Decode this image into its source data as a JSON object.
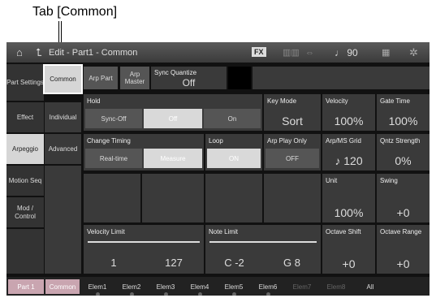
{
  "callout": {
    "label": "Tab [Common]"
  },
  "topbar": {
    "title": "Edit - Part1 - Common",
    "fx": "FX",
    "tempo": "♩ 90"
  },
  "left_tabs": [
    "Part Settings",
    "Effect",
    "Arpeggio",
    "Motion Seq",
    "Mod / Control"
  ],
  "sub_tabs": [
    "Common",
    "Individual",
    "Advanced"
  ],
  "arp_buttons": {
    "arp_part": "Arp Part",
    "arp_master": "Arp Master",
    "sync_quantize_label": "Sync Quantize",
    "sync_quantize_value": "Off"
  },
  "row1": {
    "hold": "Hold",
    "hold_opts": [
      "Sync-Off",
      "Off",
      "On"
    ],
    "key_mode": "Key Mode",
    "key_mode_val": "Sort",
    "velocity": "Velocity",
    "velocity_val": "100%",
    "gate_time": "Gate Time",
    "gate_time_val": "100%"
  },
  "row2": {
    "change_timing": "Change Timing",
    "timing_opts": [
      "Real-time",
      "Measure"
    ],
    "loop": "Loop",
    "loop_val": "ON",
    "arp_play_only": "Arp Play Only",
    "arp_play_only_val": "OFF",
    "grid": "Arp/MS Grid",
    "grid_val": "120",
    "qntz": "Qntz Strength",
    "qntz_val": "0%"
  },
  "row3": {
    "unit": "Unit",
    "unit_val": "100%",
    "swing": "Swing",
    "swing_val": "+0"
  },
  "row4": {
    "vel_limit": "Velocity Limit",
    "vel_lo": "1",
    "vel_hi": "127",
    "note_limit": "Note Limit",
    "note_lo": "C -2",
    "note_hi": "G 8",
    "oct_shift": "Octave Shift",
    "oct_shift_val": "+0",
    "oct_range": "Octave Range",
    "oct_range_val": "+0"
  },
  "bottom": {
    "part": "Part 1",
    "common": "Common",
    "elems": [
      "Elem1",
      "Elem2",
      "Elem3",
      "Elem4",
      "Elem5",
      "Elem6",
      "Elem7",
      "Elem8"
    ],
    "all": "All"
  }
}
